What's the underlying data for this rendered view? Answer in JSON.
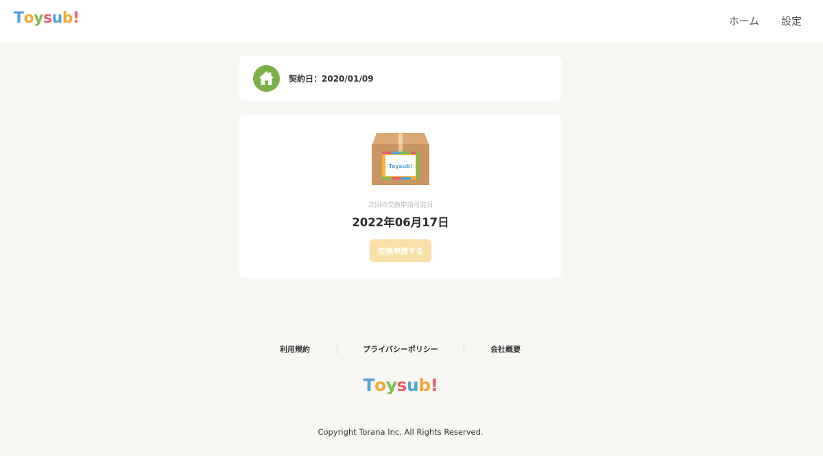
{
  "header": {
    "logo_text": [
      "T",
      "o",
      "y",
      "s",
      "u",
      "b",
      "!"
    ],
    "nav": {
      "home_label": "ホーム",
      "settings_label": "設定"
    }
  },
  "contract": {
    "icon": "house-icon",
    "text": "契約日：2020/01/09",
    "badge_color": "#7bb248"
  },
  "exchange": {
    "box_image": "cardboard-box-icon",
    "box_label": "Toysub!",
    "next_label": "次回の交換申請可能日",
    "next_date": "2022年06月17日",
    "button_label": "交換申請する",
    "button_color": "#f8e0a8"
  },
  "footer": {
    "links": [
      "利用規約",
      "プライバシーポリシー",
      "会社概要"
    ],
    "logo_text": [
      "T",
      "o",
      "y",
      "s",
      "u",
      "b",
      "!"
    ],
    "copyright": "Copyright Torana Inc. All Rights Reserved."
  },
  "colors": {
    "background": "#f8f7f4",
    "card": "#ffffff",
    "logo": [
      "#4fa3d9",
      "#f2a93b",
      "#7cbf4b",
      "#e95d6e",
      "#4fa3d9",
      "#f2a93b",
      "#e95d6e"
    ]
  }
}
